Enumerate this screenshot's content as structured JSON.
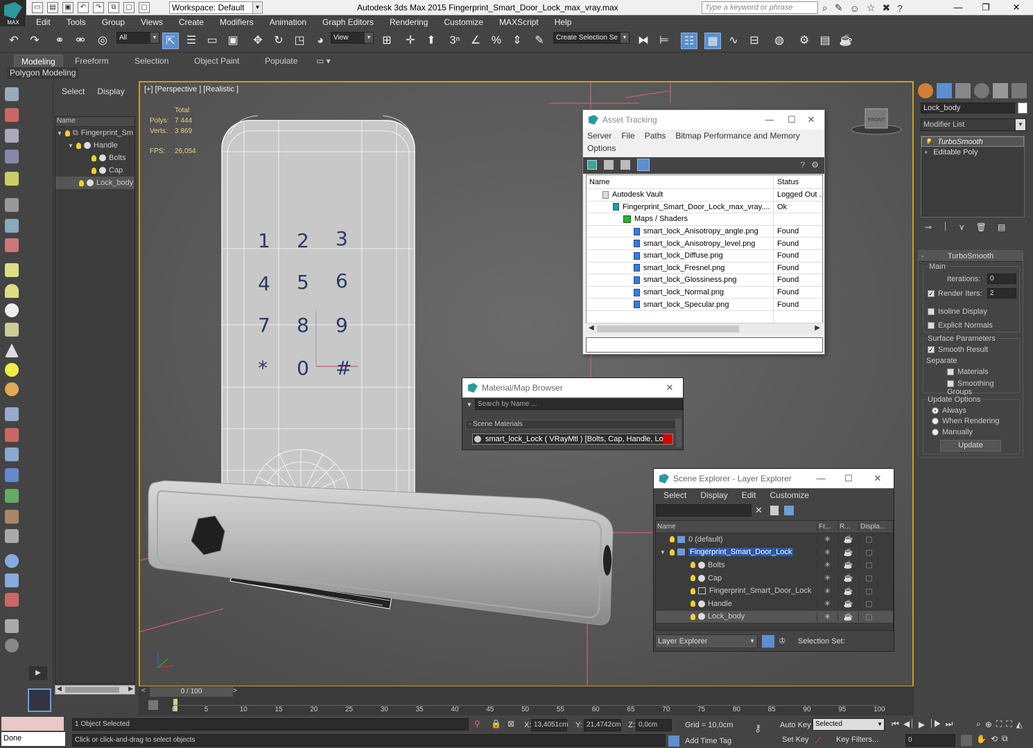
{
  "app": {
    "logo_text": "MAX",
    "title": "Autodesk 3ds Max  2015    Fingerprint_Smart_Door_Lock_max_vray.max",
    "workspace": "Workspace: Default",
    "search_placeholder": "Type a keyword or phrase"
  },
  "menu": [
    "Edit",
    "Tools",
    "Group",
    "Views",
    "Create",
    "Modifiers",
    "Animation",
    "Graph Editors",
    "Rendering",
    "Customize",
    "MAXScript",
    "Help"
  ],
  "toolbar": {
    "filter": "All",
    "ref_coord": "View",
    "selection_set": "Create Selection Se"
  },
  "ribbon": {
    "tabs": [
      "Modeling",
      "Freeform",
      "Selection",
      "Object Paint",
      "Populate"
    ],
    "active": "Modeling",
    "sub_label": "Polygon Modeling"
  },
  "side_explorer": {
    "tabs": [
      "Select",
      "Display"
    ],
    "column": "Name",
    "items": [
      {
        "label": "Fingerprint_Sm",
        "indent": 0
      },
      {
        "label": "Handle",
        "indent": 1
      },
      {
        "label": "Bolts",
        "indent": 2
      },
      {
        "label": "Cap",
        "indent": 2
      },
      {
        "label": "Lock_body",
        "indent": 1
      }
    ]
  },
  "viewport": {
    "label": "[+] [Perspective ] [Realistic ]",
    "stats": {
      "total_label": "Total",
      "polys_label": "Polys:",
      "polys": "7 444",
      "verts_label": "Verts:",
      "verts": "3 869",
      "fps_label": "FPS:",
      "fps": "26,054"
    },
    "keypad": [
      "1",
      "2",
      "3",
      "4",
      "5",
      "6",
      "7",
      "8",
      "9",
      "*",
      "0",
      "#"
    ],
    "viewcube_label": "FRONT"
  },
  "asset_tracking": {
    "title": "Asset Tracking",
    "menu": [
      "Server",
      "File",
      "Paths",
      "Bitmap Performance and Memory"
    ],
    "menu2": "Options",
    "columns": [
      "Name",
      "Status"
    ],
    "rows": [
      {
        "name": "Autodesk Vault",
        "status": "Logged Out ...",
        "level": 1,
        "icon": "vault"
      },
      {
        "name": "Fingerprint_Smart_Door_Lock_max_vray....",
        "status": "Ok",
        "level": 2,
        "icon": "max"
      },
      {
        "name": "Maps / Shaders",
        "status": "",
        "level": 3,
        "icon": "folder"
      },
      {
        "name": "smart_lock_Anisotropy_angle.png",
        "status": "Found",
        "level": 4,
        "icon": "file"
      },
      {
        "name": "smart_lock_Anisotropy_level.png",
        "status": "Found",
        "level": 4,
        "icon": "file"
      },
      {
        "name": "smart_lock_Diffuse.png",
        "status": "Found",
        "level": 4,
        "icon": "file"
      },
      {
        "name": "smart_lock_Fresnel.png",
        "status": "Found",
        "level": 4,
        "icon": "file"
      },
      {
        "name": "smart_lock_Glossiness.png",
        "status": "Found",
        "level": 4,
        "icon": "file"
      },
      {
        "name": "smart_lock_Normal.png",
        "status": "Found",
        "level": 4,
        "icon": "file"
      },
      {
        "name": "smart_lock_Specular.png",
        "status": "Found",
        "level": 4,
        "icon": "file"
      },
      {
        "name": "",
        "status": "",
        "level": 0,
        "icon": ""
      }
    ]
  },
  "material_browser": {
    "title": "Material/Map Browser",
    "search_placeholder": "Search by Name ...",
    "group": "- Scene Materials",
    "material": "smart_lock_Lock  ( VRayMtl ) [Bolts, Cap, Handle, Loc..."
  },
  "scene_explorer": {
    "title": "Scene Explorer - Layer Explorer",
    "menu": [
      "Select",
      "Display",
      "Edit",
      "Customize"
    ],
    "columns": [
      "Name",
      "Fr...",
      "R...",
      "Displa..."
    ],
    "rows": [
      {
        "label": "0 (default)",
        "indent": 0,
        "type": "layer",
        "selected": false,
        "expander": ""
      },
      {
        "label": "Fingerprint_Smart_Door_Lock",
        "indent": 0,
        "type": "layer",
        "selected": true,
        "expander": "▼"
      },
      {
        "label": "Bolts",
        "indent": 1,
        "type": "object",
        "selected": false,
        "expander": ""
      },
      {
        "label": "Cap",
        "indent": 1,
        "type": "object",
        "selected": false,
        "expander": ""
      },
      {
        "label": "Fingerprint_Smart_Door_Lock",
        "indent": 1,
        "type": "group",
        "selected": false,
        "expander": ""
      },
      {
        "label": "Handle",
        "indent": 1,
        "type": "object",
        "selected": false,
        "expander": ""
      },
      {
        "label": "Lock_body",
        "indent": 1,
        "type": "object",
        "selected": false,
        "expander": "",
        "hl": true
      }
    ],
    "footer_dropdown": "Layer Explorer",
    "selection_set_label": "Selection Set:"
  },
  "command_panel": {
    "object_name": "Lock_body",
    "modifier_list": "Modifier List",
    "stack": [
      "TurboSmooth",
      "Editable Poly"
    ],
    "rollout_title": "TurboSmooth",
    "main_label": "Main",
    "iterations_label": "Iterations:",
    "iterations": "0",
    "render_iters_label": "Render Iters:",
    "render_iters": "2",
    "render_iters_checked": true,
    "isoline": "Isoline Display",
    "explicit_normals": "Explicit Normals",
    "surface_params": "Surface Parameters",
    "smooth_result": "Smooth Result",
    "separate_label": "Separate",
    "materials": "Materials",
    "smoothing_groups": "Smoothing Groups",
    "update_options": "Update Options",
    "always": "Always",
    "when_rendering": "When Rendering",
    "manually": "Manually",
    "update_btn": "Update"
  },
  "timeline": {
    "slider": "0 / 100",
    "ticks": [
      "5",
      "10",
      "15",
      "20",
      "25",
      "30",
      "35",
      "40",
      "45",
      "50",
      "55",
      "60",
      "65",
      "70",
      "75",
      "80",
      "85",
      "90",
      "95",
      "100"
    ],
    "tick_start": "0"
  },
  "status": {
    "done": "Done",
    "selected": "1 Object Selected",
    "prompt": "Click or click-and-drag to select objects",
    "x_label": "X:",
    "x": "13,4051cm",
    "y_label": "Y:",
    "y": "21,4742cm",
    "z_label": "Z:",
    "z": "0,0cm",
    "grid": "Grid = 10,0cm",
    "add_time_tag": "Add Time Tag",
    "auto_key": "Auto Key",
    "set_key": "Set Key",
    "key_mode": "Selected",
    "key_filters": "Key Filters...",
    "frame": "0"
  }
}
